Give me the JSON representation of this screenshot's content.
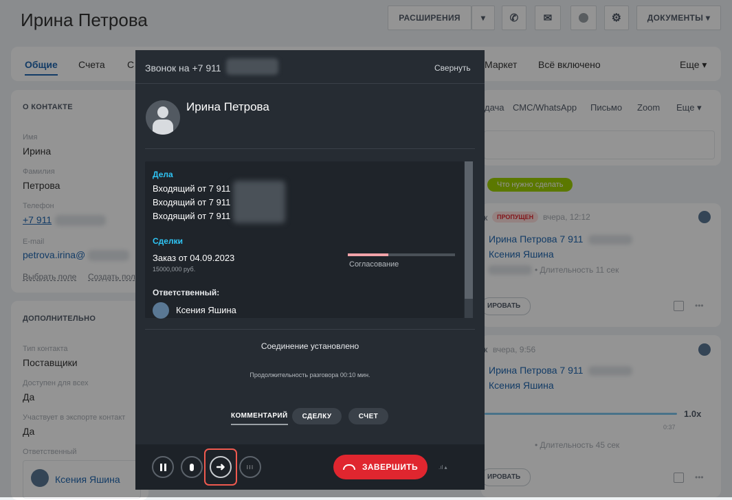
{
  "header": {
    "title": "Ирина Петрова",
    "ext_label": "РАСШИРЕНИЯ",
    "docs_label": "ДОКУМЕНТЫ"
  },
  "tabs": {
    "general": "Общие",
    "accounts": "Счета",
    "clipped": "С",
    "market": "Маркет",
    "all_included": "Всё включено",
    "more": "Еще"
  },
  "contact": {
    "section": "О КОНТАКТЕ",
    "name_label": "Имя",
    "name": "Ирина",
    "surname_label": "Фамилия",
    "surname": "Петрова",
    "phone_label": "Телефон",
    "phone": "+7 911",
    "email_label": "E-mail",
    "email": "petrova.irina@",
    "choose_field": "Выбрать поле",
    "create_field": "Создать пол"
  },
  "extra": {
    "section": "ДОПОЛНИТЕЛЬНО",
    "type_label": "Тип контакта",
    "type": "Поставщики",
    "access_label": "Доступен для всех",
    "access": "Да",
    "export_label": "Участвует в экспорте контакт",
    "export": "Да",
    "resp_label": "Ответственный",
    "resp": "Ксения Яшина"
  },
  "activity": {
    "tabs": [
      "дача",
      "СМС/WhatsApp",
      "Письмо",
      "Zoom",
      "Еще"
    ],
    "todo_badge": "Что нужно сделать",
    "item1": {
      "prefix": "к",
      "badge": "ПРОПУЩЕН",
      "time": "вчера, 12:12",
      "title": "Ирина Петрова 7 911",
      "person": "Ксения Яшина",
      "duration": "• Длительность 11 сек",
      "btn": "ИРОВАТЬ"
    },
    "item2": {
      "prefix": "к",
      "time": "вчера, 9:56",
      "title": "Ирина Петрова 7 911",
      "person": "Ксения Яшина",
      "speed": "1.0x",
      "player_time": "0:37",
      "duration": "• Длительность 45 сек",
      "btn": "ИРОВАТЬ"
    },
    "more_dots": "•••"
  },
  "call": {
    "title": "Звонок на +7 911",
    "minimize": "Свернуть",
    "contact_name": "Ирина Петрова",
    "deals_header": "Дела",
    "deals": [
      "Входящий от 7 911",
      "Входящий от 7 911",
      "Входящий от 7 911"
    ],
    "sdelki_header": "Сделки",
    "order": "Заказ от 04.09.2023",
    "amount": "15000,000 руб.",
    "stage": "Согласование",
    "progress": 0.38,
    "responsible_header": "Ответственный:",
    "responsible": "Ксения Яшина",
    "status": "Соединение установлено",
    "duration": "Продолжительность разговора 00:10 мин.",
    "actions": [
      "КОММЕНТАРИЙ",
      "СДЕЛКУ",
      "СЧЕТ"
    ],
    "end_call": "ЗАВЕРШИТЬ"
  },
  "colors": {
    "accent": "#2067b0",
    "highlight": "#f05a4f",
    "end_call": "#e0262f",
    "todo_badge": "#9dcf00"
  }
}
